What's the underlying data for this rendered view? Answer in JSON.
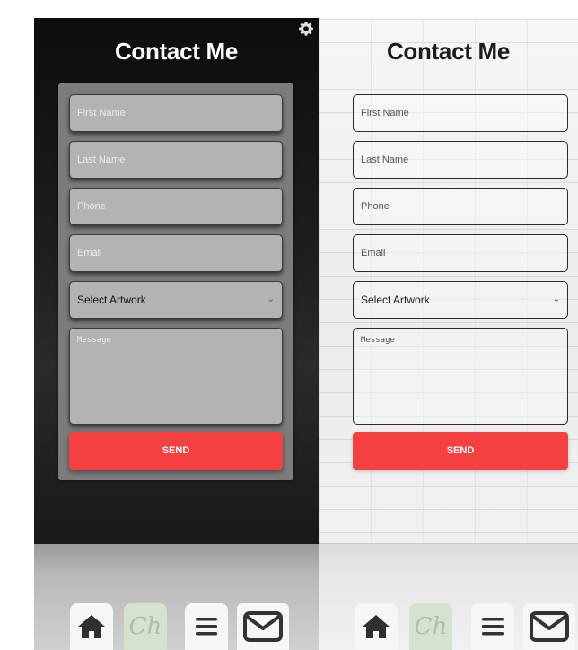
{
  "panels": [
    {
      "theme": "dark",
      "title": "Contact Me",
      "fields": {
        "first_name_placeholder": "First Name",
        "last_name_placeholder": "Last Name",
        "phone_placeholder": "Phone",
        "email_placeholder": "Email",
        "artwork_select_value": "Select Artwork",
        "message_placeholder": "Message"
      },
      "send_label": "SEND",
      "has_settings_icon": true
    },
    {
      "theme": "light",
      "title": "Contact Me",
      "fields": {
        "first_name_placeholder": "First Name",
        "last_name_placeholder": "Last Name",
        "phone_placeholder": "Phone",
        "email_placeholder": "Email",
        "artwork_select_value": "Select Artwork",
        "message_placeholder": "Message"
      },
      "send_label": "SEND",
      "has_settings_icon": false
    }
  ],
  "nav": {
    "icons": [
      "home-icon",
      "logo-icon",
      "menu-icon",
      "mail-icon"
    ],
    "logo_text": "Ch"
  },
  "colors": {
    "send_button": "#f44040",
    "dark_form_bg": "#7c7c7c",
    "logo_bg": "#d4e3cf"
  }
}
